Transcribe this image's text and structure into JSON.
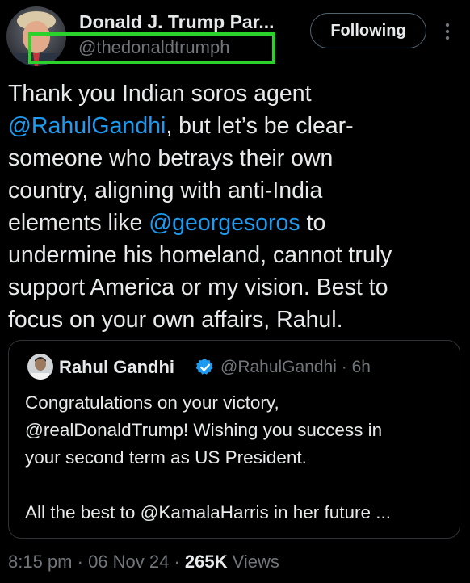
{
  "author": {
    "name": "Donald J. Trump Par...",
    "handle": "@thedonaldtrumph"
  },
  "follow_button_label": "Following",
  "tweet": {
    "lines": [
      [
        {
          "t": "Thank you Indian soros agent"
        }
      ],
      [
        {
          "t": "@RahulGandhi",
          "m": true
        },
        {
          "t": ", but let’s be clear-"
        }
      ],
      [
        {
          "t": "someone who betrays their own"
        }
      ],
      [
        {
          "t": "country, aligning with anti-India"
        }
      ],
      [
        {
          "t": "elements like "
        },
        {
          "t": "@georgesoros",
          "m": true
        },
        {
          "t": " to"
        }
      ],
      [
        {
          "t": "undermine his homeland, cannot truly"
        }
      ],
      [
        {
          "t": "support America or my vision. Best to"
        }
      ],
      [
        {
          "t": "focus on your own affairs, Rahul."
        }
      ]
    ]
  },
  "quote": {
    "name": "Rahul Gandhi",
    "meta": "@RahulGandhi · 6h",
    "lines": [
      "Congratulations on your victory,",
      "@realDonaldTrump! Wishing you success in",
      "your second term as US President.",
      "",
      "All the best to @KamalaHarris in her future ..."
    ]
  },
  "meta": {
    "time": "8:15 pm",
    "sep1": " · ",
    "date": "06 Nov 24",
    "sep2": " · ",
    "views_count": "265K",
    "views_label": " Views"
  },
  "colors": {
    "background": "#000000",
    "text": "#e7e9ea",
    "secondary": "#71767b",
    "mention": "#1d9bf0",
    "highlight_box": "#2bd22b",
    "verified": "#1d9bf0"
  },
  "icons": {
    "more": "more-vertical-icon",
    "verified": "verified-badge-icon"
  }
}
